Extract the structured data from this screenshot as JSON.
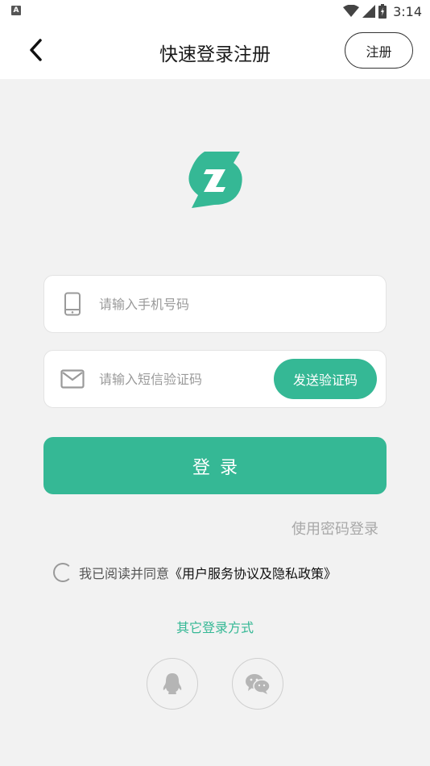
{
  "status_bar": {
    "notification_letter": "A",
    "time": "3:14",
    "icons": [
      "wifi-icon",
      "signal-icon",
      "battery-icon"
    ]
  },
  "header": {
    "back_icon": "chevron-left-icon",
    "title": "快速登录注册",
    "register_label": "注册"
  },
  "logo": {
    "icon": "app-logo-icon",
    "color": "#35b895"
  },
  "form": {
    "phone": {
      "icon": "phone-icon",
      "placeholder": "请输入手机号码",
      "value": ""
    },
    "code": {
      "icon": "mail-icon",
      "placeholder": "请输入短信验证码",
      "value": "",
      "send_label": "发送验证码"
    },
    "login_label": "登录",
    "password_login_label": "使用密码登录"
  },
  "agreement": {
    "checked": false,
    "prefix": "我已阅读并同意",
    "link_text": "《用户服务协议及隐私政策》"
  },
  "other_login": {
    "title": "其它登录方式",
    "options": [
      {
        "icon": "qq-icon"
      },
      {
        "icon": "wechat-icon"
      }
    ]
  },
  "colors": {
    "accent": "#35b895",
    "background": "#f2f2f2"
  }
}
